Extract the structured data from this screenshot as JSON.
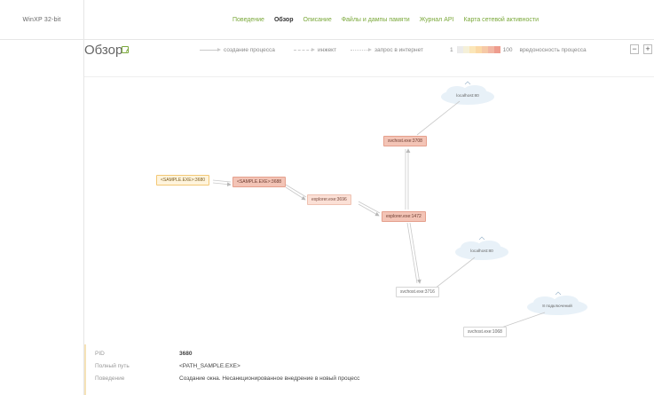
{
  "header": {
    "os_label": "WinXP 32-bit",
    "nav": [
      {
        "label": "Поведение",
        "active": false
      },
      {
        "label": "Обзор",
        "active": true
      },
      {
        "label": "Описание",
        "active": false
      },
      {
        "label": "Файлы и дампы памяти",
        "active": false
      },
      {
        "label": "Журнал API",
        "active": false
      },
      {
        "label": "Карта сетевой активности",
        "active": false
      }
    ]
  },
  "overview": {
    "title": "Обзор",
    "legend": {
      "create_process": "создание процесса",
      "inject": "инжект",
      "internet_request": "запрос в интернет",
      "scale_min": "1",
      "scale_max": "100",
      "scale_label": "вредоносность процесса",
      "scale_colors": [
        "#ebebeb",
        "#f5f0d8",
        "#fbe6b8",
        "#fbd9a6",
        "#f6c9a6",
        "#f2b6a3",
        "#ee9d8e"
      ]
    },
    "zoom_out": "−",
    "zoom_in": "+"
  },
  "graph": {
    "nodes": [
      {
        "id": "sample_root",
        "label": "<SAMPLE.EXE>:3680",
        "style": "yellow"
      },
      {
        "id": "sample_child",
        "label": "<SAMPLE.EXE>:3688",
        "style": "orange"
      },
      {
        "id": "explorer_3696",
        "label": "explorer.exe:3696",
        "style": "light"
      },
      {
        "id": "explorer_1472",
        "label": "explorer.exe:1472",
        "style": "orange"
      },
      {
        "id": "svchost_3708",
        "label": "svchost.exe:3708",
        "style": "orange"
      },
      {
        "id": "svchost_3716",
        "label": "svchost.exe:3716",
        "style": "white"
      },
      {
        "id": "svchost_1068",
        "label": "svchost.exe:1068",
        "style": "white"
      }
    ],
    "clouds": [
      {
        "id": "cloud_1",
        "label": "localhost:80"
      },
      {
        "id": "cloud_2",
        "label": "localhost:80"
      },
      {
        "id": "cloud_3",
        "label": "8 подключений"
      }
    ]
  },
  "details": {
    "rows": [
      {
        "key": "PID",
        "value": "3680"
      },
      {
        "key": "Полный путь",
        "value": "<PATH_SAMPLE.EXE>"
      },
      {
        "key": "Поведение",
        "value": "Создание окна. Несанкционированное внедрение в новый процесс"
      }
    ]
  }
}
